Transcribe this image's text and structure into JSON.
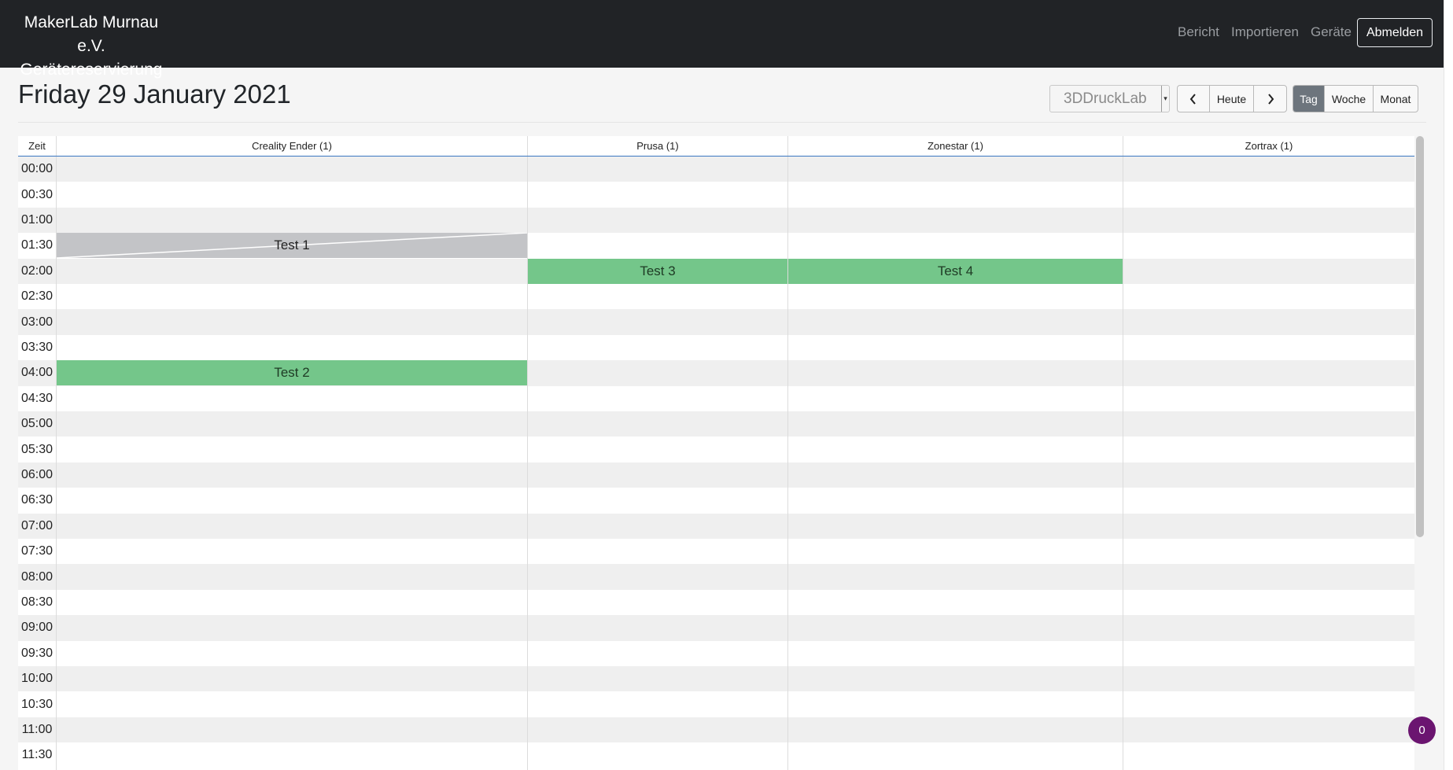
{
  "navbar": {
    "brand_line1": "MakerLab Murnau e.V.",
    "brand_line2": "Gerätereservierung",
    "links": [
      "Bericht",
      "Importieren",
      "Geräte"
    ],
    "logout_label": "Abmelden"
  },
  "page": {
    "title": "Friday 29 January 2021"
  },
  "toolbar": {
    "location_select": "3DDruckLab",
    "prev_icon": "chevron-left-icon",
    "today_label": "Heute",
    "next_icon": "chevron-right-icon",
    "views": [
      "Tag",
      "Woche",
      "Monat"
    ],
    "active_view": "Tag"
  },
  "calendar": {
    "time_header": "Zeit",
    "resources": [
      "Creality Ender (1)",
      "Prusa (1)",
      "Zonestar (1)",
      "Zortrax (1)"
    ],
    "times": [
      "00:00",
      "00:30",
      "01:00",
      "01:30",
      "02:00",
      "02:30",
      "03:00",
      "03:30",
      "04:00",
      "04:30",
      "05:00",
      "05:30",
      "06:00",
      "06:30",
      "07:00",
      "07:30",
      "08:00",
      "08:30",
      "09:00",
      "09:30",
      "10:00",
      "10:30",
      "11:00",
      "11:30"
    ],
    "events": [
      {
        "title": "Test 1",
        "resource": "Creality Ender (1)",
        "start": "01:30",
        "end": "02:00",
        "style": "gray"
      },
      {
        "title": "Test 3",
        "resource": "Prusa (1)",
        "start": "02:00",
        "end": "02:30",
        "style": "green"
      },
      {
        "title": "Test 4",
        "resource": "Zonestar (1)",
        "start": "02:00",
        "end": "02:30",
        "style": "green"
      },
      {
        "title": "Test 2",
        "resource": "Creality Ender (1)",
        "start": "04:00",
        "end": "04:30",
        "style": "green"
      }
    ]
  },
  "colors": {
    "navbar": "#212326",
    "event_green": "#74c68a",
    "event_gray": "#c3c4c7",
    "badge": "#6b1570",
    "header_rule": "#3b78c2"
  },
  "badge": {
    "count": "0"
  }
}
